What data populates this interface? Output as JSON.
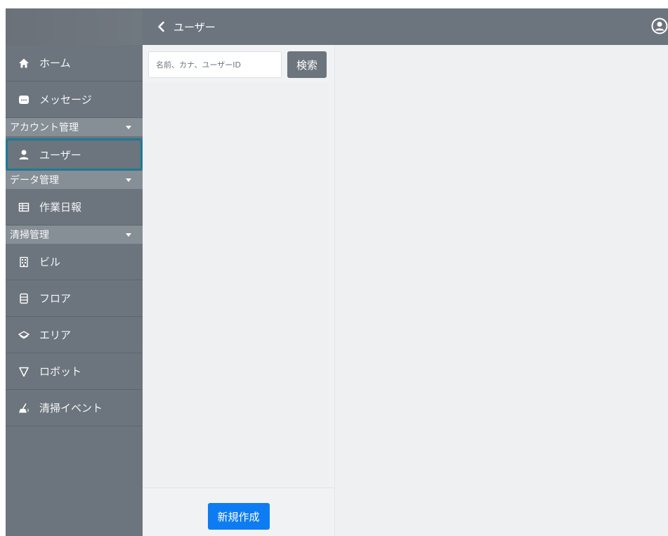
{
  "header": {
    "title": "ユーザー"
  },
  "sidebar": {
    "top_items": [
      {
        "label": "ホーム",
        "icon": "home-icon"
      },
      {
        "label": "メッセージ",
        "icon": "message-icon"
      }
    ],
    "sections": [
      {
        "label": "アカウント管理",
        "items": [
          {
            "label": "ユーザー",
            "icon": "user-icon",
            "active": true
          }
        ]
      },
      {
        "label": "データ管理",
        "items": [
          {
            "label": "作業日報",
            "icon": "table-icon"
          }
        ]
      },
      {
        "label": "清掃管理",
        "items": [
          {
            "label": "ビル",
            "icon": "building-icon"
          },
          {
            "label": "フロア",
            "icon": "floor-icon"
          },
          {
            "label": "エリア",
            "icon": "area-icon"
          },
          {
            "label": "ロボット",
            "icon": "robot-icon"
          },
          {
            "label": "清掃イベント",
            "icon": "broom-icon"
          }
        ]
      }
    ]
  },
  "search": {
    "placeholder": "名前、カナ、ユーザーID",
    "button_label": "検索"
  },
  "list": {
    "create_label": "新規作成"
  },
  "colors": {
    "sidebar": "#6c757d",
    "section_header": "#868e96",
    "active_outline": "#1c7a96",
    "primary": "#0d7cf2"
  }
}
